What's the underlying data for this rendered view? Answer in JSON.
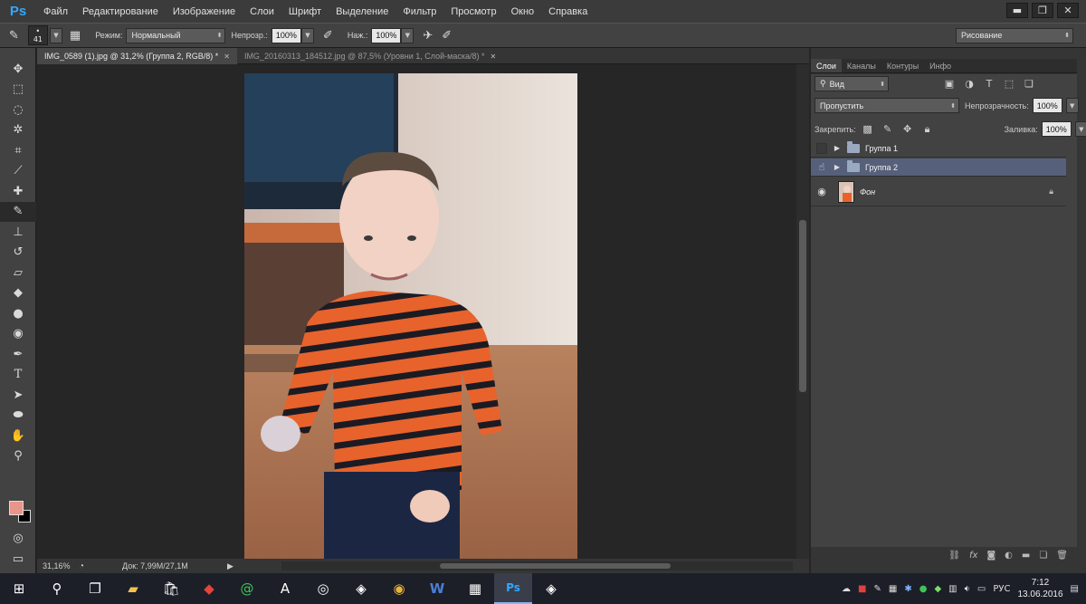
{
  "app": {
    "logo": "Ps"
  },
  "menu": [
    "Файл",
    "Редактирование",
    "Изображение",
    "Слои",
    "Шрифт",
    "Выделение",
    "Фильтр",
    "Просмотр",
    "Окно",
    "Справка"
  ],
  "window_controls": {
    "minimize": "▬",
    "restore": "❐",
    "close": "✕"
  },
  "options": {
    "brush_size": "41",
    "mode_label": "Режим:",
    "mode_value": "Нормальный",
    "opacity_label": "Непрозр.:",
    "opacity_value": "100%",
    "flow_label": "Наж.:",
    "flow_value": "100%",
    "workspace": "Рисование"
  },
  "documents": [
    {
      "title": "IMG_0589 (1).jpg @ 31,2% (Группа 2, RGB/8) *",
      "active": true
    },
    {
      "title": "IMG_20160313_184512.jpg @ 87,5% (Уровни 1, Слой-маска/8) *",
      "active": false
    }
  ],
  "status": {
    "zoom": "31,16%",
    "doc_info": "Док: 7,99M/27,1M"
  },
  "layers_panel": {
    "tabs": [
      "Слои",
      "Каналы",
      "Контуры",
      "Инфо"
    ],
    "filter_label": "Вид",
    "blend_mode": "Пропустить",
    "opacity_label": "Непрозрачность:",
    "opacity_value": "100%",
    "lock_label": "Закрепить:",
    "fill_label": "Заливка:",
    "fill_value": "100%",
    "layers": [
      {
        "name": "Группа 1",
        "type": "group",
        "visible": false,
        "selected": false
      },
      {
        "name": "Группа 2",
        "type": "group",
        "visible": true,
        "selected": true
      },
      {
        "name": "Фон",
        "type": "image",
        "visible": true,
        "selected": false,
        "locked": true
      }
    ]
  },
  "colors": {
    "foreground": "#e8958a",
    "background": "#000000",
    "accent": "#31a8ff",
    "selection": "#57607a"
  },
  "taskbar": {
    "language": "РУС",
    "time": "7:12",
    "date": "13.06.2016"
  }
}
